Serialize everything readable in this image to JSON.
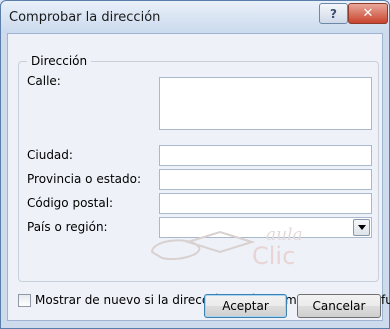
{
  "window": {
    "title": "Comprobar la dirección",
    "help_label": "?",
    "close_label": "✕"
  },
  "group": {
    "legend": "Dirección",
    "fields": {
      "street": {
        "label": "Calle:",
        "value": ""
      },
      "city": {
        "label": "Ciudad:",
        "value": ""
      },
      "state": {
        "label": "Provincia o estado:",
        "value": ""
      },
      "postal": {
        "label": "Código postal:",
        "value": ""
      },
      "country": {
        "label": "País o región:",
        "value": ""
      }
    }
  },
  "checkbox": {
    "label": "Mostrar de nuevo si la dirección está incompleta o es confusa",
    "checked": false
  },
  "buttons": {
    "ok": "Aceptar",
    "cancel": "Cancelar"
  },
  "watermark": {
    "line1": "aula",
    "line2": "Clic"
  },
  "colors": {
    "accent": "#3c7fb1",
    "close_red": "#c8442d"
  }
}
